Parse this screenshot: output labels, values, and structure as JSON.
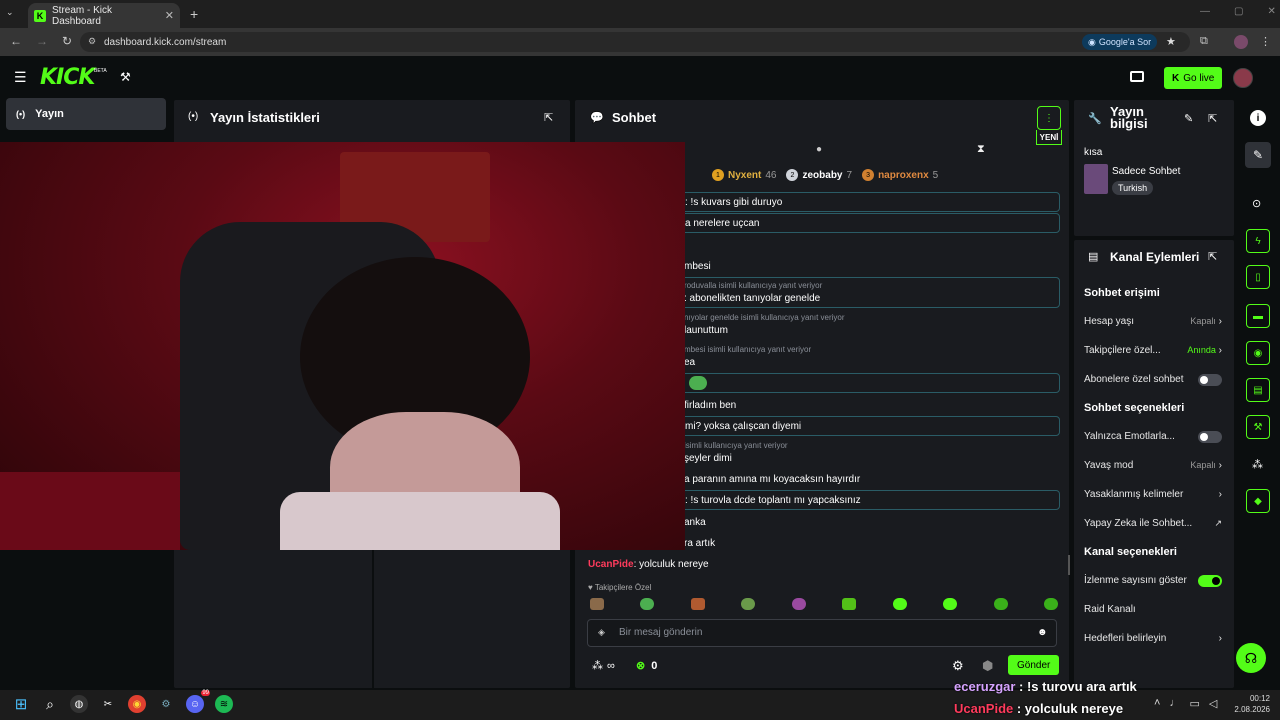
{
  "browser": {
    "tab_title": "Stream - Kick Dashboard",
    "url": "dashboard.kick.com/stream",
    "google_btn": "Google'a Sor"
  },
  "topnav": {
    "logo": "KICK",
    "beta": "BETA",
    "go_live": "Go live"
  },
  "sidebar": {
    "active_item": "Yayın"
  },
  "stats": {
    "title": "Yayın İstatistikleri"
  },
  "chat": {
    "title": "Sohbet",
    "new_badge": "YENİ",
    "leaders": [
      {
        "rank": "1",
        "name": "Nyxent",
        "count": "46"
      },
      {
        "rank": "2",
        "name": "zeobaby",
        "count": "7"
      },
      {
        "rank": "3",
        "name": "naproxenx",
        "count": "5"
      }
    ],
    "messages": [
      {
        "text": ": !s kuvars gibi duruyo",
        "reply": ""
      },
      {
        "text": "a nerelere uçcan",
        "reply": ""
      },
      {
        "text": "mbesi",
        "reply": ""
      },
      {
        "text": ": abonelikten tanıyolar genelde",
        "reply": "roduvalla isimli kullanıcıya yanıt veriyor"
      },
      {
        "text": "launuttum",
        "reply": "nıyolar genelde isimli kullanıcıya yanıt veriyor"
      },
      {
        "text": "ea",
        "reply": "mbesi isimli kullanıcıya yanıt veriyor"
      },
      {
        "text": "",
        "reply": ""
      },
      {
        "text": "firladım ben",
        "reply": ""
      },
      {
        "text": "mi? yoksa çalışcan diyemi",
        "reply": ""
      },
      {
        "text": "şeyler dimi",
        "reply": "isimli kullanıcıya yanıt veriyor"
      },
      {
        "text": "a paranın amına mı koyacaksın hayırdır",
        "reply": ""
      },
      {
        "text": ": !s turovla dcde toplantı mı yapcaksınız",
        "reply": ""
      },
      {
        "text": "anka",
        "reply": ""
      },
      {
        "text": "ra artık",
        "reply": ""
      }
    ],
    "last_user": "UcanPide",
    "last_text": ": yolculuk nereye",
    "followers_only": "Takipçilere Özel",
    "input_placeholder": "Bir mesaj gönderin",
    "points": "∞",
    "kick_count": "0",
    "send": "Gönder"
  },
  "stream_info": {
    "title": "Yayın bilgisi",
    "label": "kısa",
    "category": "Sadece Sohbet",
    "language": "Turkish"
  },
  "channel_actions": {
    "title": "Kanal Eylemleri",
    "chat_access": "Sohbet erişimi",
    "account_age": "Hesap yaşı",
    "account_age_val": "Kapalı",
    "followers_only": "Takipçilere özel...",
    "followers_only_val": "Anında",
    "subs_only": "Abonelere özel sohbet",
    "chat_options": "Sohbet seçenekleri",
    "emotes_only": "Yalnızca Emotlarla...",
    "slow_mode": "Yavaş mod",
    "slow_mode_val": "Kapalı",
    "banned_words": "Yasaklanmış kelimeler",
    "ai_chat": "Yapay Zeka ile Sohbet...",
    "channel_options": "Kanal seçenekleri",
    "show_viewers": "İzlenme sayısını göster",
    "raid": "Raid Kanalı",
    "goals": "Hedefleri belirleyin"
  },
  "overlay": {
    "line1_user": "eceruzgar",
    "line1_text": " : !s turovu ara artık",
    "line2_user": "UcanPide",
    "line2_text": " : yolculuk nereye"
  },
  "taskbar": {
    "time": "00:12",
    "date": "2.08.2026",
    "badge": "99"
  },
  "colors": {
    "accent": "#53fc18",
    "overlay_user": "#d6a3ff",
    "red_user": "#ff3b5c"
  }
}
